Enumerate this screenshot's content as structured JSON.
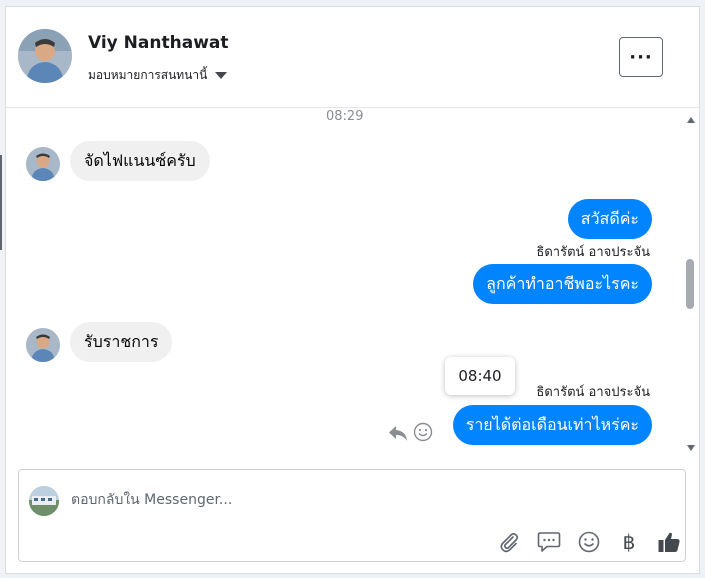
{
  "header": {
    "contact_name": "Viy Nanthawat",
    "assign_label": "มอบหมายการสนทนานี้",
    "more_label": "···"
  },
  "thread": {
    "top_time": "08:29",
    "messages": [
      {
        "direction": "in",
        "text": "จัดไฟแนนซ์ครับ"
      },
      {
        "direction": "out",
        "text": "สวัสดีค่ะ"
      },
      {
        "direction": "out",
        "sender": "ธิดารัตน์ อาจประจัน",
        "text": "ลูกค้าทำอาชีพอะไรคะ"
      },
      {
        "direction": "in",
        "text": "รับราชการ"
      },
      {
        "direction": "out",
        "sender": "ธิดารัตน์ อาจประจัน",
        "text": "รายได้ต่อเดือนเท่าไหร่คะ"
      }
    ],
    "hover_time": "08:40"
  },
  "composer": {
    "placeholder": "ตอบกลับใน Messenger..."
  },
  "tools": {
    "baht_symbol": "฿"
  },
  "colors": {
    "outgoing_bubble": "#0084ff",
    "incoming_bubble": "#f0f0f0",
    "icon_gray": "#606770"
  }
}
